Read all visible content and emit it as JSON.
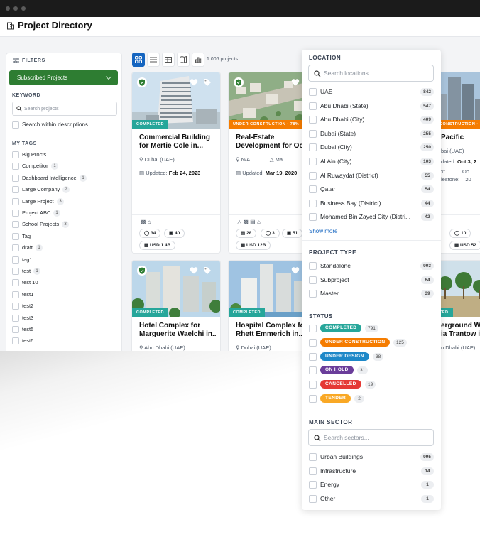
{
  "header": {
    "title": "Project Directory"
  },
  "filters": {
    "title": "FILTERS",
    "subscribed_label": "Subscribed Projects",
    "keyword_label": "KEYWORD",
    "keyword_placeholder": "Search projects",
    "within_desc_label": "Search within descriptions",
    "my_tags_label": "MY TAGS",
    "tags": [
      {
        "label": "Big Procts",
        "count": ""
      },
      {
        "label": "Competitor",
        "count": "1"
      },
      {
        "label": "Dashboard Intelligence",
        "count": "1"
      },
      {
        "label": "Large Company",
        "count": "2"
      },
      {
        "label": "Large Project",
        "count": "3"
      },
      {
        "label": "Project ABC",
        "count": "1"
      },
      {
        "label": "School Projects",
        "count": "3"
      },
      {
        "label": "Tag",
        "count": ""
      },
      {
        "label": "draft",
        "count": "1"
      },
      {
        "label": "tag1",
        "count": ""
      },
      {
        "label": "test",
        "count": "1"
      },
      {
        "label": "test 10",
        "count": ""
      },
      {
        "label": "test1",
        "count": ""
      },
      {
        "label": "test2",
        "count": ""
      },
      {
        "label": "test3",
        "count": ""
      },
      {
        "label": "test5",
        "count": ""
      },
      {
        "label": "test6",
        "count": ""
      }
    ]
  },
  "toolbar": {
    "view_icons": [
      "grid-view-icon",
      "list-view-icon",
      "table-view-icon",
      "map-view-icon",
      "chart-view-icon"
    ],
    "count_text": "1 006 projects"
  },
  "cards": [
    {
      "status": "COMPLETED",
      "status_color": "#26a69a",
      "title1": "Commercial Building",
      "title2": "for Mertie Cole in...",
      "location": "Dubai (UAE)",
      "updated_label": "Updated:",
      "updated": "Feb 24, 2023",
      "chips_row1": [
        "34",
        "40"
      ],
      "value": "USD 1.4B",
      "image": "tower-image"
    },
    {
      "status": "UNDER CONSTRUCTION · 78%",
      "status_color": "#f57c00",
      "title1": "Real-Estate",
      "title2": "Development for Ocie...",
      "location": "N/A",
      "updated_label": "Updated:",
      "updated": "Mar 19, 2020",
      "chips_row1": [
        "28",
        "3",
        "51"
      ],
      "value": "USD 12B",
      "image": "aerial-image"
    },
    {
      "status": "CONSTRUCTION · 7",
      "status_color": "#f57c00",
      "title1": "Pacific",
      "title2": "",
      "location": "bai (UAE)",
      "updated_label": "dated:",
      "updated": "Oct 3, 2",
      "chips_row1": [
        "10"
      ],
      "value": "USD 52",
      "image": "skyscraper-image",
      "extra1": "xt",
      "extra1v": "Oc",
      "extra2": "lestone:",
      "extra2v": "20",
      "chip_a": "7"
    },
    {
      "status": "COMPLETED",
      "status_color": "#26a69a",
      "title1": "Hotel Complex for",
      "title2": "Marguerite Waelchi in...",
      "location": "Abu Dhabi (UAE)",
      "image": "hotel-image"
    },
    {
      "status": "COMPLETED",
      "status_color": "#26a69a",
      "title1": "Hospital Complex for",
      "title2": "Rhett Emmerich in...",
      "location": "Dubai (UAE)",
      "image": "hospital-image"
    },
    {
      "status": "TED",
      "status_color": "#26a69a",
      "title1": "erground Wo",
      "title2": "ia Trantow in",
      "location": "u Dhabi (UAE)",
      "image": "palm-image"
    }
  ],
  "dropdown": {
    "location": {
      "title": "LOCATION",
      "placeholder": "Search locations...",
      "items": [
        {
          "label": "UAE",
          "count": "842"
        },
        {
          "label": "Abu Dhabi (State)",
          "count": "547"
        },
        {
          "label": "Abu Dhabi (City)",
          "count": "409"
        },
        {
          "label": "Dubai (State)",
          "count": "255"
        },
        {
          "label": "Dubai (City)",
          "count": "250"
        },
        {
          "label": "Al Ain (City)",
          "count": "103"
        },
        {
          "label": "Al Ruwaydat (District)",
          "count": "55"
        },
        {
          "label": "Qatar",
          "count": "54"
        },
        {
          "label": "Business Bay (District)",
          "count": "44"
        },
        {
          "label": "Mohamed Bin Zayed City (Distri...",
          "count": "42"
        }
      ],
      "show_more": "Show more"
    },
    "project_type": {
      "title": "PROJECT TYPE",
      "items": [
        {
          "label": "Standalone",
          "count": "903"
        },
        {
          "label": "Subproject",
          "count": "64"
        },
        {
          "label": "Master",
          "count": "39"
        }
      ]
    },
    "status": {
      "title": "STATUS",
      "items": [
        {
          "label": "COMPLETED",
          "count": "791",
          "color": "#26a69a"
        },
        {
          "label": "UNDER CONSTRUCTION",
          "count": "125",
          "color": "#f57c00"
        },
        {
          "label": "UNDER DESIGN",
          "count": "38",
          "color": "#1e88c8"
        },
        {
          "label": "ON HOLD",
          "count": "31",
          "color": "#6a3d9a"
        },
        {
          "label": "CANCELLED",
          "count": "19",
          "color": "#e53935"
        },
        {
          "label": "TENDER",
          "count": "2",
          "color": "#f9a825"
        }
      ]
    },
    "main_sector": {
      "title": "MAIN SECTOR",
      "placeholder": "Search sectors...",
      "items": [
        {
          "label": "Urban Buildings",
          "count": "995"
        },
        {
          "label": "Infrastructure",
          "count": "14"
        },
        {
          "label": "Energy",
          "count": "1"
        },
        {
          "label": "Other",
          "count": "1"
        }
      ]
    }
  }
}
